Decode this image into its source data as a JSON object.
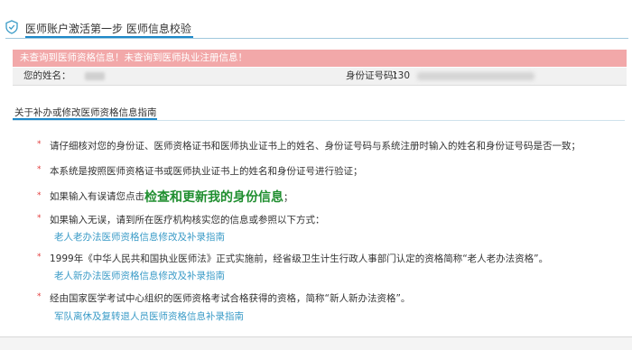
{
  "header": {
    "title": "医师账户激活第一步 医师信息校验",
    "icon": "shield-icon"
  },
  "alert": {
    "message": "未查询到医师资格信息！未查询到医师执业注册信息！",
    "color": "#f2a8a9"
  },
  "user_info": {
    "name_label": "您的姓名：",
    "id_label": "身份证号码：",
    "id_prefix": "130"
  },
  "section": {
    "title": "关于补办或修改医师资格信息指南"
  },
  "guides": [
    {
      "text": "请仔细核对您的身份证、医师资格证书和医师执业证书上的姓名、身份证号码与系统注册时输入的姓名和身份证号码是否一致；"
    },
    {
      "text": "本系统是按照医师资格证书或医师执业证书上的姓名和身份证号进行验证；"
    },
    {
      "text_before": "如果输入有误请您点击",
      "link": "检查和更新我的身份信息",
      "text_after": "；"
    },
    {
      "text": "如果输入无误，请到所在医疗机构核实您的信息或参照以下方式：",
      "sub_link": "老人老办法医师资格信息修改及补录指南"
    },
    {
      "text": "1999年《中华人民共和国执业医师法》正式实施前，经省级卫生计生行政人事部门认定的资格简称“老人老办法资格”。",
      "sub_link": "老人新办法医师资格信息修改及补录指南"
    },
    {
      "text": "经由国家医学考试中心组织的医师资格考试合格获得的资格，简称“新人新办法资格”。",
      "sub_link": "军队离休及复转退人员医师资格信息补录指南"
    }
  ],
  "colors": {
    "accent": "#1e88c8",
    "star": "#e23b3b",
    "link": "#3a9bc7",
    "action_link": "#1f8e2f"
  }
}
